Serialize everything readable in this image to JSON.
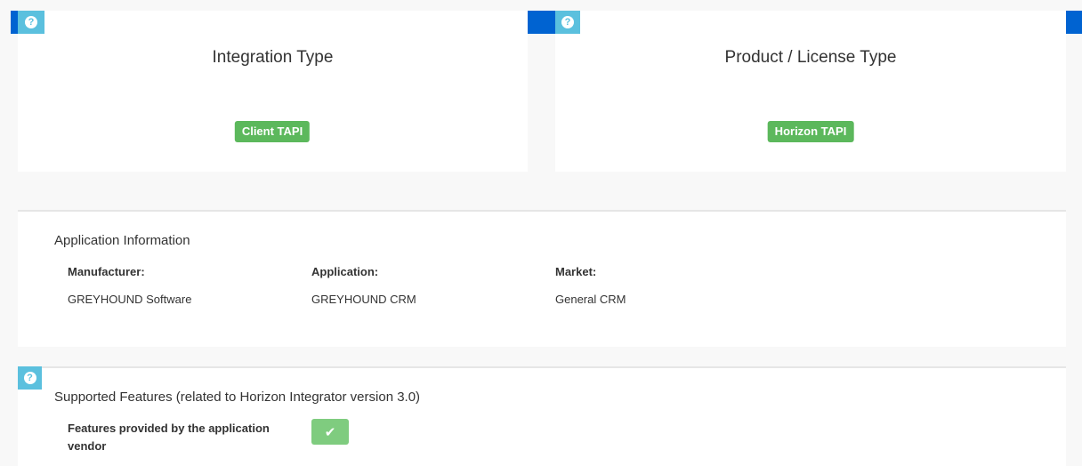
{
  "integration_card": {
    "title": "Integration Type",
    "badge": "Client TAPI",
    "help_icon": "question-circle-icon"
  },
  "product_card": {
    "title": "Product / License Type",
    "badge": "Horizon TAPI",
    "help_icon": "question-circle-icon"
  },
  "app_info": {
    "title": "Application Information",
    "fields": [
      {
        "label": "Manufacturer:",
        "value": "GREYHOUND Software"
      },
      {
        "label": "Application:",
        "value": "GREYHOUND CRM"
      },
      {
        "label": "Market:",
        "value": "General CRM"
      }
    ]
  },
  "features": {
    "title": "Supported Features (related to Horizon Integrator version 3.0)",
    "row_label": "Features provided by the application vendor",
    "status_icon": "checkmark-icon",
    "help_icon": "question-circle-icon"
  },
  "colors": {
    "badge_green": "#5cb85c",
    "help_blue": "#5bc0de",
    "accent_blue": "#0063d1",
    "check_green": "#7fcc7f"
  }
}
